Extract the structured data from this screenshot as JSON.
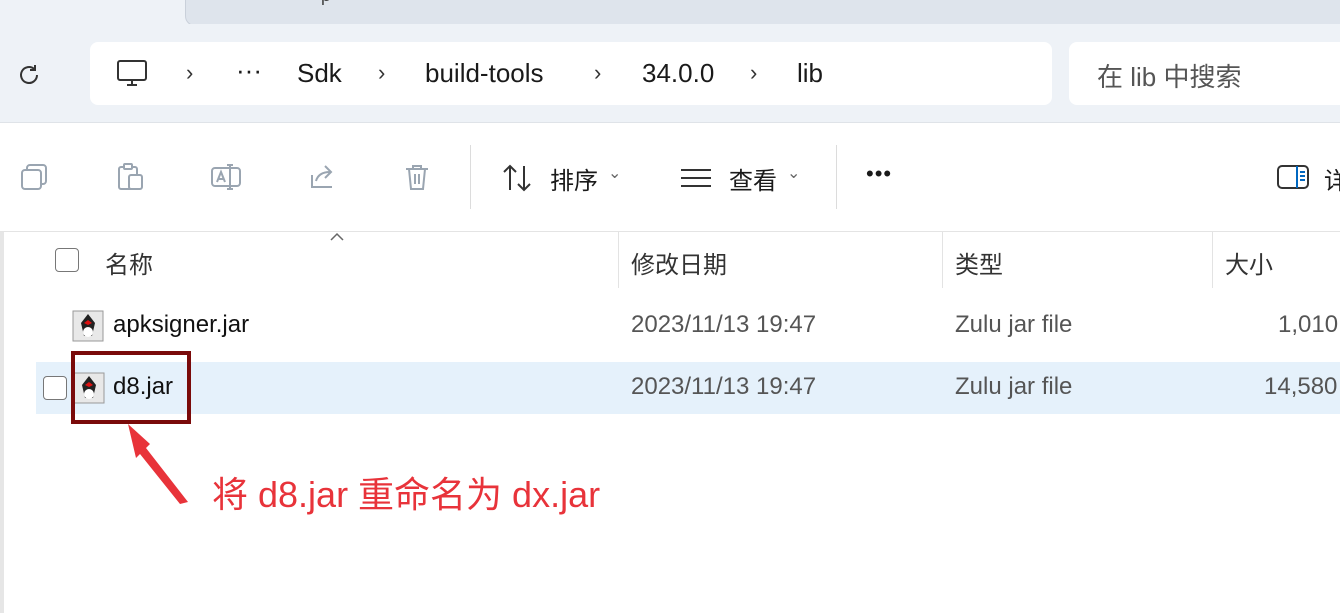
{
  "tab": {
    "glyph": "ρ"
  },
  "address": {
    "crumbs": [
      "Sdk",
      "build-tools",
      "34.0.0",
      "lib"
    ],
    "overflow": "···",
    "separator": "›"
  },
  "search": {
    "placeholder": "在 lib 中搜索"
  },
  "toolbar": {
    "sort_label": "排序",
    "view_label": "查看",
    "more_label": "•••",
    "details_label": "详"
  },
  "columns": {
    "name": "名称",
    "modified": "修改日期",
    "type": "类型",
    "size": "大小"
  },
  "files": [
    {
      "name": "apksigner.jar",
      "modified": "2023/11/13 19:47",
      "type": "Zulu jar file",
      "size": "1,010"
    },
    {
      "name": "d8.jar",
      "modified": "2023/11/13 19:47",
      "type": "Zulu jar file",
      "size": "14,580"
    }
  ],
  "annotation": {
    "text": "将 d8.jar 重命名为 dx.jar",
    "color": "#e8333a"
  },
  "colors": {
    "accent": "#0067c0",
    "selection": "#e5f1fb",
    "highlight_box": "#7a0a0a"
  }
}
